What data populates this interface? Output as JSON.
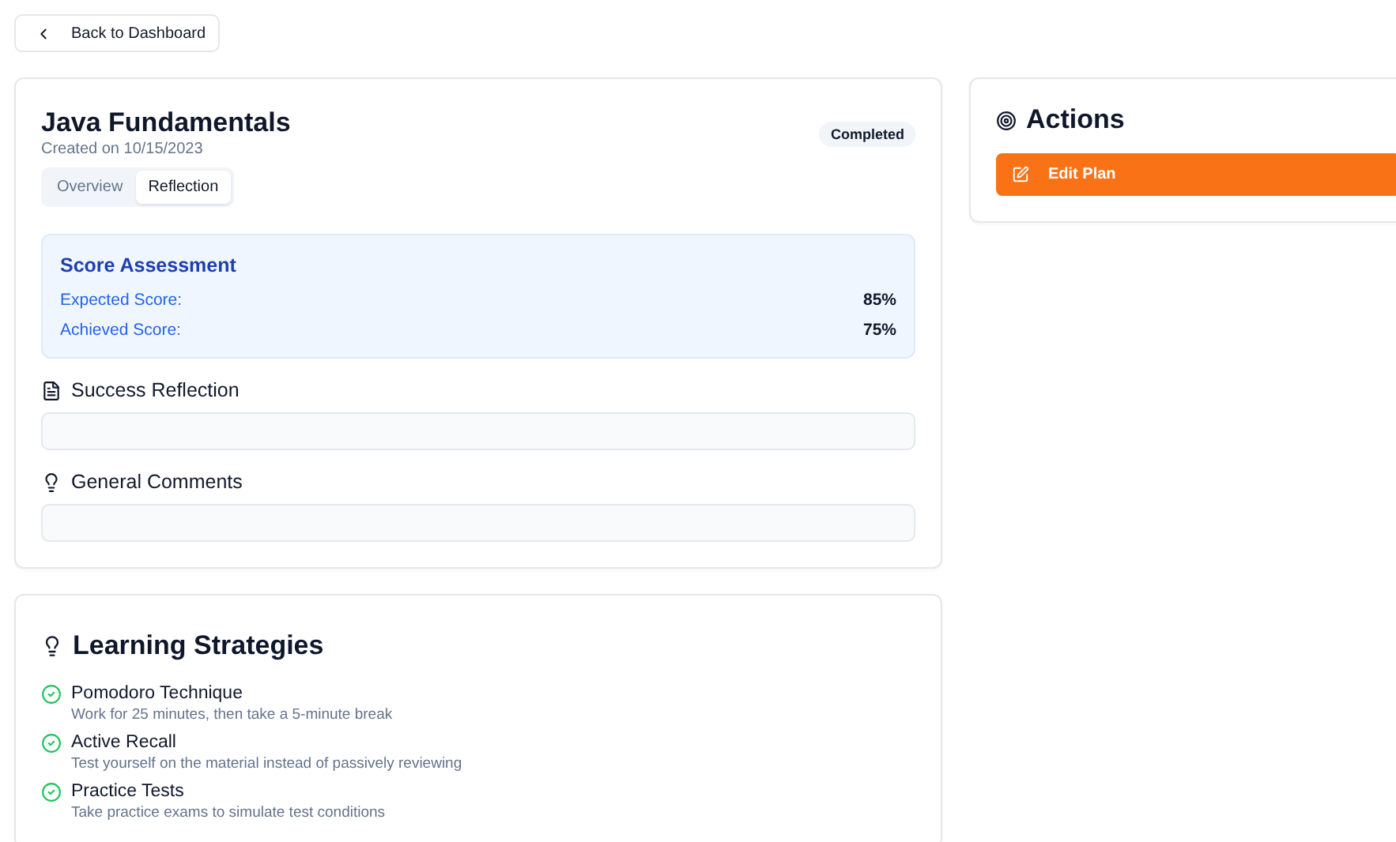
{
  "back_button": {
    "label": "Back to Dashboard"
  },
  "plan": {
    "title": "Java Fundamentals",
    "created": "Created on 10/15/2023",
    "status": "Completed",
    "tabs": [
      {
        "label": "Overview",
        "selected": false
      },
      {
        "label": "Reflection",
        "selected": true
      }
    ],
    "score_assessment": {
      "title": "Score Assessment",
      "rows": [
        {
          "label": "Expected Score:",
          "value": "85%"
        },
        {
          "label": "Achieved Score:",
          "value": "75%"
        }
      ]
    },
    "sections": [
      {
        "kind": "document",
        "title": "Success Reflection"
      },
      {
        "kind": "idea",
        "title": "General Comments"
      }
    ]
  },
  "strategies": {
    "title": "Learning Strategies",
    "items": [
      {
        "name": "Pomodoro Technique",
        "description": "Work for 25 minutes, then take a 5-minute break",
        "checked": true
      },
      {
        "name": "Active Recall",
        "description": "Test yourself on the material instead of passively reviewing",
        "checked": true
      },
      {
        "name": "Practice Tests",
        "description": "Take practice exams to simulate test conditions",
        "checked": true
      }
    ]
  },
  "actions": {
    "title": "Actions",
    "buttons": [
      {
        "label": "Edit Plan"
      }
    ]
  }
}
